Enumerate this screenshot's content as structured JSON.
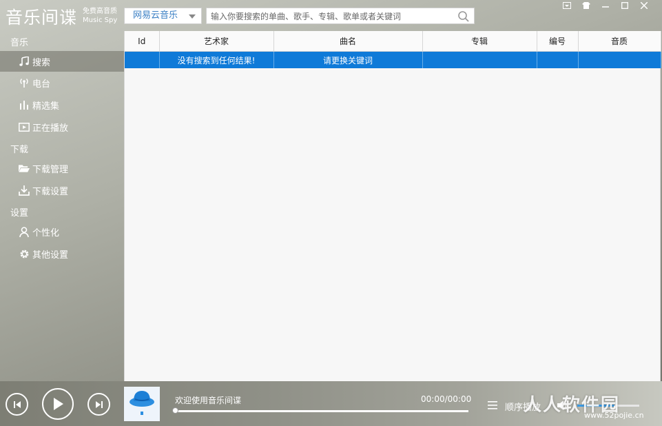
{
  "app": {
    "title": "音乐间谍",
    "subtitle_line1": "免费高音质",
    "subtitle_line2": "Music Spy"
  },
  "toolbar": {
    "source_selected": "网易云音乐",
    "search_placeholder": "输入你要搜索的单曲、歌手、专辑、歌单或者关键词"
  },
  "window_controls": [
    "dropdown-icon",
    "skin-icon",
    "minimize-icon",
    "maximize-icon",
    "close-icon"
  ],
  "sidebar": {
    "sections": [
      {
        "title": "音乐",
        "items": [
          {
            "label": "搜索",
            "icon": "music-note-icon",
            "active": true
          },
          {
            "label": "电台",
            "icon": "radio-icon"
          },
          {
            "label": "精选集",
            "icon": "bars-icon"
          },
          {
            "label": "正在播放",
            "icon": "play-screen-icon"
          }
        ]
      },
      {
        "title": "下载",
        "items": [
          {
            "label": "下载管理",
            "icon": "folder-icon"
          },
          {
            "label": "下载设置",
            "icon": "download-icon"
          }
        ]
      },
      {
        "title": "设置",
        "items": [
          {
            "label": "个性化",
            "icon": "user-icon"
          },
          {
            "label": "其他设置",
            "icon": "gear-icon"
          }
        ]
      }
    ]
  },
  "table": {
    "columns": [
      "Id",
      "艺术家",
      "曲名",
      "专辑",
      "编号",
      "音质"
    ],
    "rows": [
      [
        "",
        "没有搜索到任何结果!",
        "请更换关键词",
        "",
        "",
        ""
      ]
    ]
  },
  "player": {
    "welcome_text": "欢迎使用音乐间谍",
    "time": "00:00/00:00",
    "progress": 0,
    "play_mode": "顺序播放",
    "volume": 0.6
  },
  "watermark": {
    "text": "人人软件园",
    "url": "www.52pojie.cn"
  },
  "colors": {
    "accent": "#0f7ad8",
    "source_text": "#3a7fc4"
  }
}
